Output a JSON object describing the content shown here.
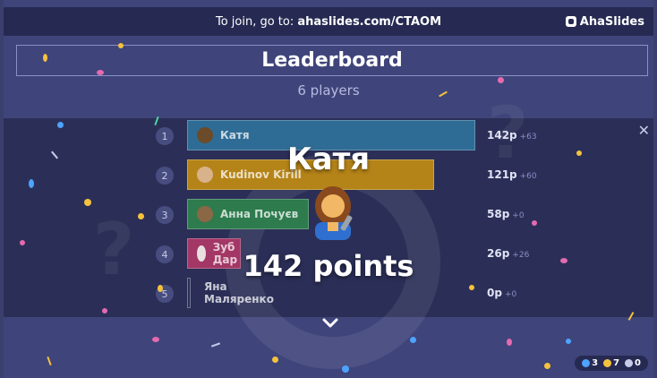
{
  "topbar": {
    "join_prefix": "To join, go to: ",
    "join_url": "ahaslides.com/CTAOM",
    "brand": "AhaSlides"
  },
  "leaderboard": {
    "title": "Leaderboard",
    "players": "6 players"
  },
  "rows": [
    {
      "rank": "1",
      "name": "Катя",
      "score": "142p",
      "delta": "+63",
      "color": "#2f6c95"
    },
    {
      "rank": "2",
      "name": "Kudinov Kirill",
      "score": "121p",
      "delta": "+60",
      "color": "#b58418"
    },
    {
      "rank": "3",
      "name": "Анна Почуєв",
      "score": "58p",
      "delta": "+0",
      "color": "#2e7b4e"
    },
    {
      "rank": "4",
      "name": "Зуб Дар",
      "score": "26p",
      "delta": "+26",
      "color": "#a33766"
    },
    {
      "rank": "5",
      "name": "Яна Маляренко",
      "score": "0p",
      "delta": "+0",
      "color": "transparent"
    }
  ],
  "winner": {
    "name": "Катя",
    "points": "142 points"
  },
  "stats": {
    "responses": "3",
    "reactions": "7",
    "audience": "0"
  },
  "colors": {
    "background": "#3f447a",
    "board": "#2b2f57",
    "topbar": "#262a52"
  },
  "icons": {
    "close": "close-icon",
    "chevron": "chevron-down-icon",
    "brand": "ahaslides-logo-icon"
  }
}
